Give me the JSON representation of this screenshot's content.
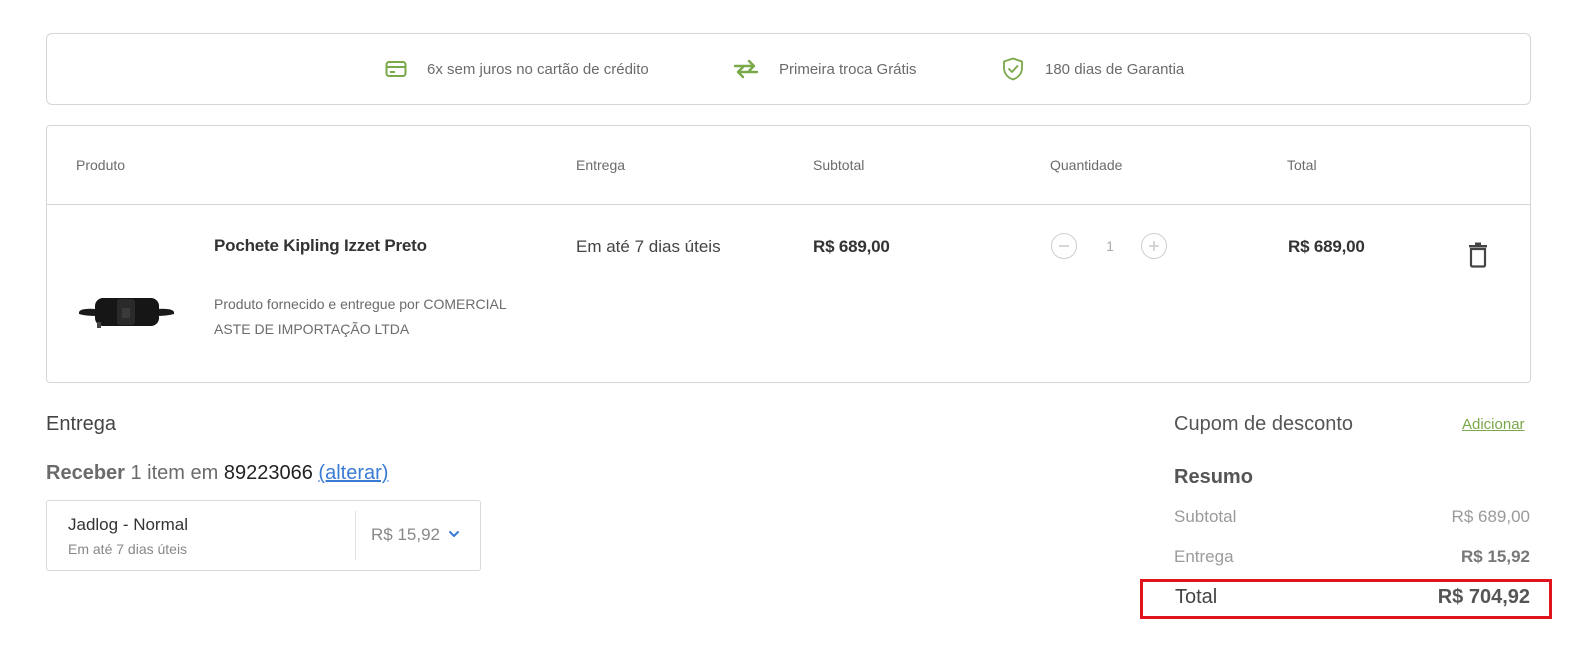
{
  "benefits": [
    {
      "icon": "credit-card-icon",
      "label": "6x sem juros no cartão de crédito"
    },
    {
      "icon": "exchange-arrows-icon",
      "label": "Primeira troca Grátis"
    },
    {
      "icon": "shield-check-icon",
      "label": "180 dias de Garantia"
    }
  ],
  "colors": {
    "accent": "#7aa84a",
    "link": "#3a7bd5",
    "highlight": "#e0141e"
  },
  "cart": {
    "headers": {
      "product": "Produto",
      "delivery": "Entrega",
      "subtotal": "Subtotal",
      "quantity": "Quantidade",
      "total": "Total"
    },
    "item": {
      "name": "Pochete Kipling Izzet Preto",
      "seller": "Produto fornecido e entregue por COMERCIAL ASTE DE IMPORTAÇÃO LTDA",
      "delivery": "Em até 7 dias úteis",
      "subtotal": "R$ 689,00",
      "quantity": "1",
      "total": "R$ 689,00"
    }
  },
  "shipping": {
    "title": "Entrega",
    "receive_label": "Receber",
    "receive_middle": " 1 item em ",
    "cep": "89223066",
    "change_link": "(alterar)",
    "option_name": "Jadlog - Normal",
    "option_eta": "Em até 7 dias úteis",
    "option_price": "R$ 15,92"
  },
  "summary": {
    "coupon_title": "Cupom de desconto",
    "coupon_add": "Adicionar",
    "title": "Resumo",
    "subtotal_label": "Subtotal",
    "subtotal_value": "R$ 689,00",
    "delivery_label": "Entrega",
    "delivery_value": "R$ 15,92",
    "total_label": "Total",
    "total_value": "R$ 704,92"
  }
}
